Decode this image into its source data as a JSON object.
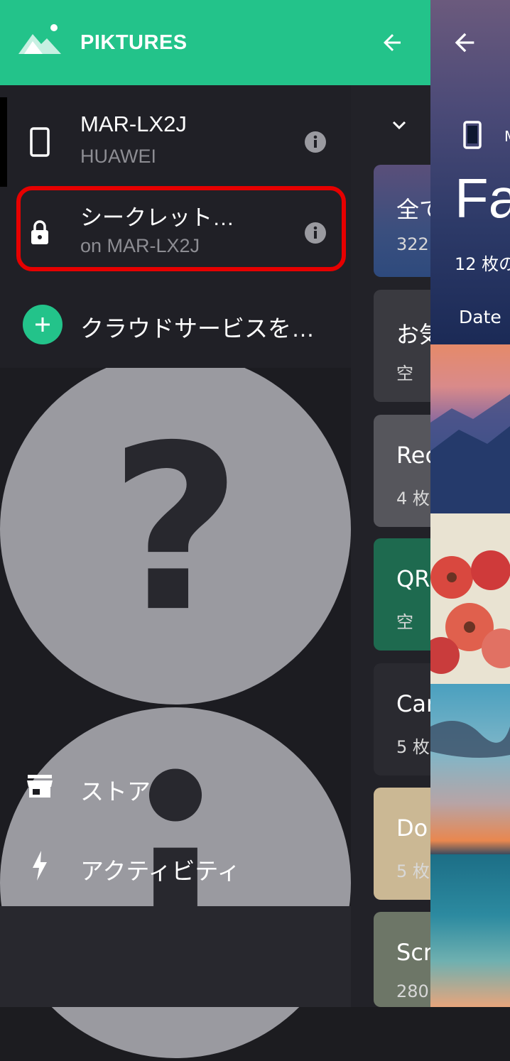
{
  "drawer": {
    "brand": "PIKTURES",
    "sources": [
      {
        "title": "MAR-LX2J",
        "subtitle": "HUAWEI",
        "icon": "phone-icon"
      },
      {
        "title": "シークレット…",
        "subtitle": "on MAR-LX2J",
        "icon": "lock-icon"
      }
    ],
    "add_cloud": "クラウドサービスを…",
    "menu": [
      {
        "label": "ストア",
        "icon": "store-icon"
      },
      {
        "label": "アクティビティ",
        "icon": "bolt-icon"
      }
    ],
    "footer_icons": [
      "settings-icon",
      "help-icon",
      "info-icon"
    ]
  },
  "middle": {
    "albums": [
      {
        "title": "全て",
        "subtitle": "322"
      },
      {
        "title": "お気",
        "subtitle": "空"
      },
      {
        "title": "Rec",
        "subtitle": "4 枚"
      },
      {
        "title": "QR",
        "subtitle": "空"
      },
      {
        "title": "Car",
        "subtitle": "5 枚"
      },
      {
        "title": "Do",
        "subtitle": "5 枚"
      },
      {
        "title": "Scr",
        "subtitle": "280"
      }
    ]
  },
  "detail": {
    "device_initial": "M",
    "title": "Fa",
    "count": "12 枚の",
    "sort_label": "Date"
  },
  "colors": {
    "accent": "#23c38a",
    "drawer_bg": "#1c1c21",
    "highlight": "#e60000"
  }
}
